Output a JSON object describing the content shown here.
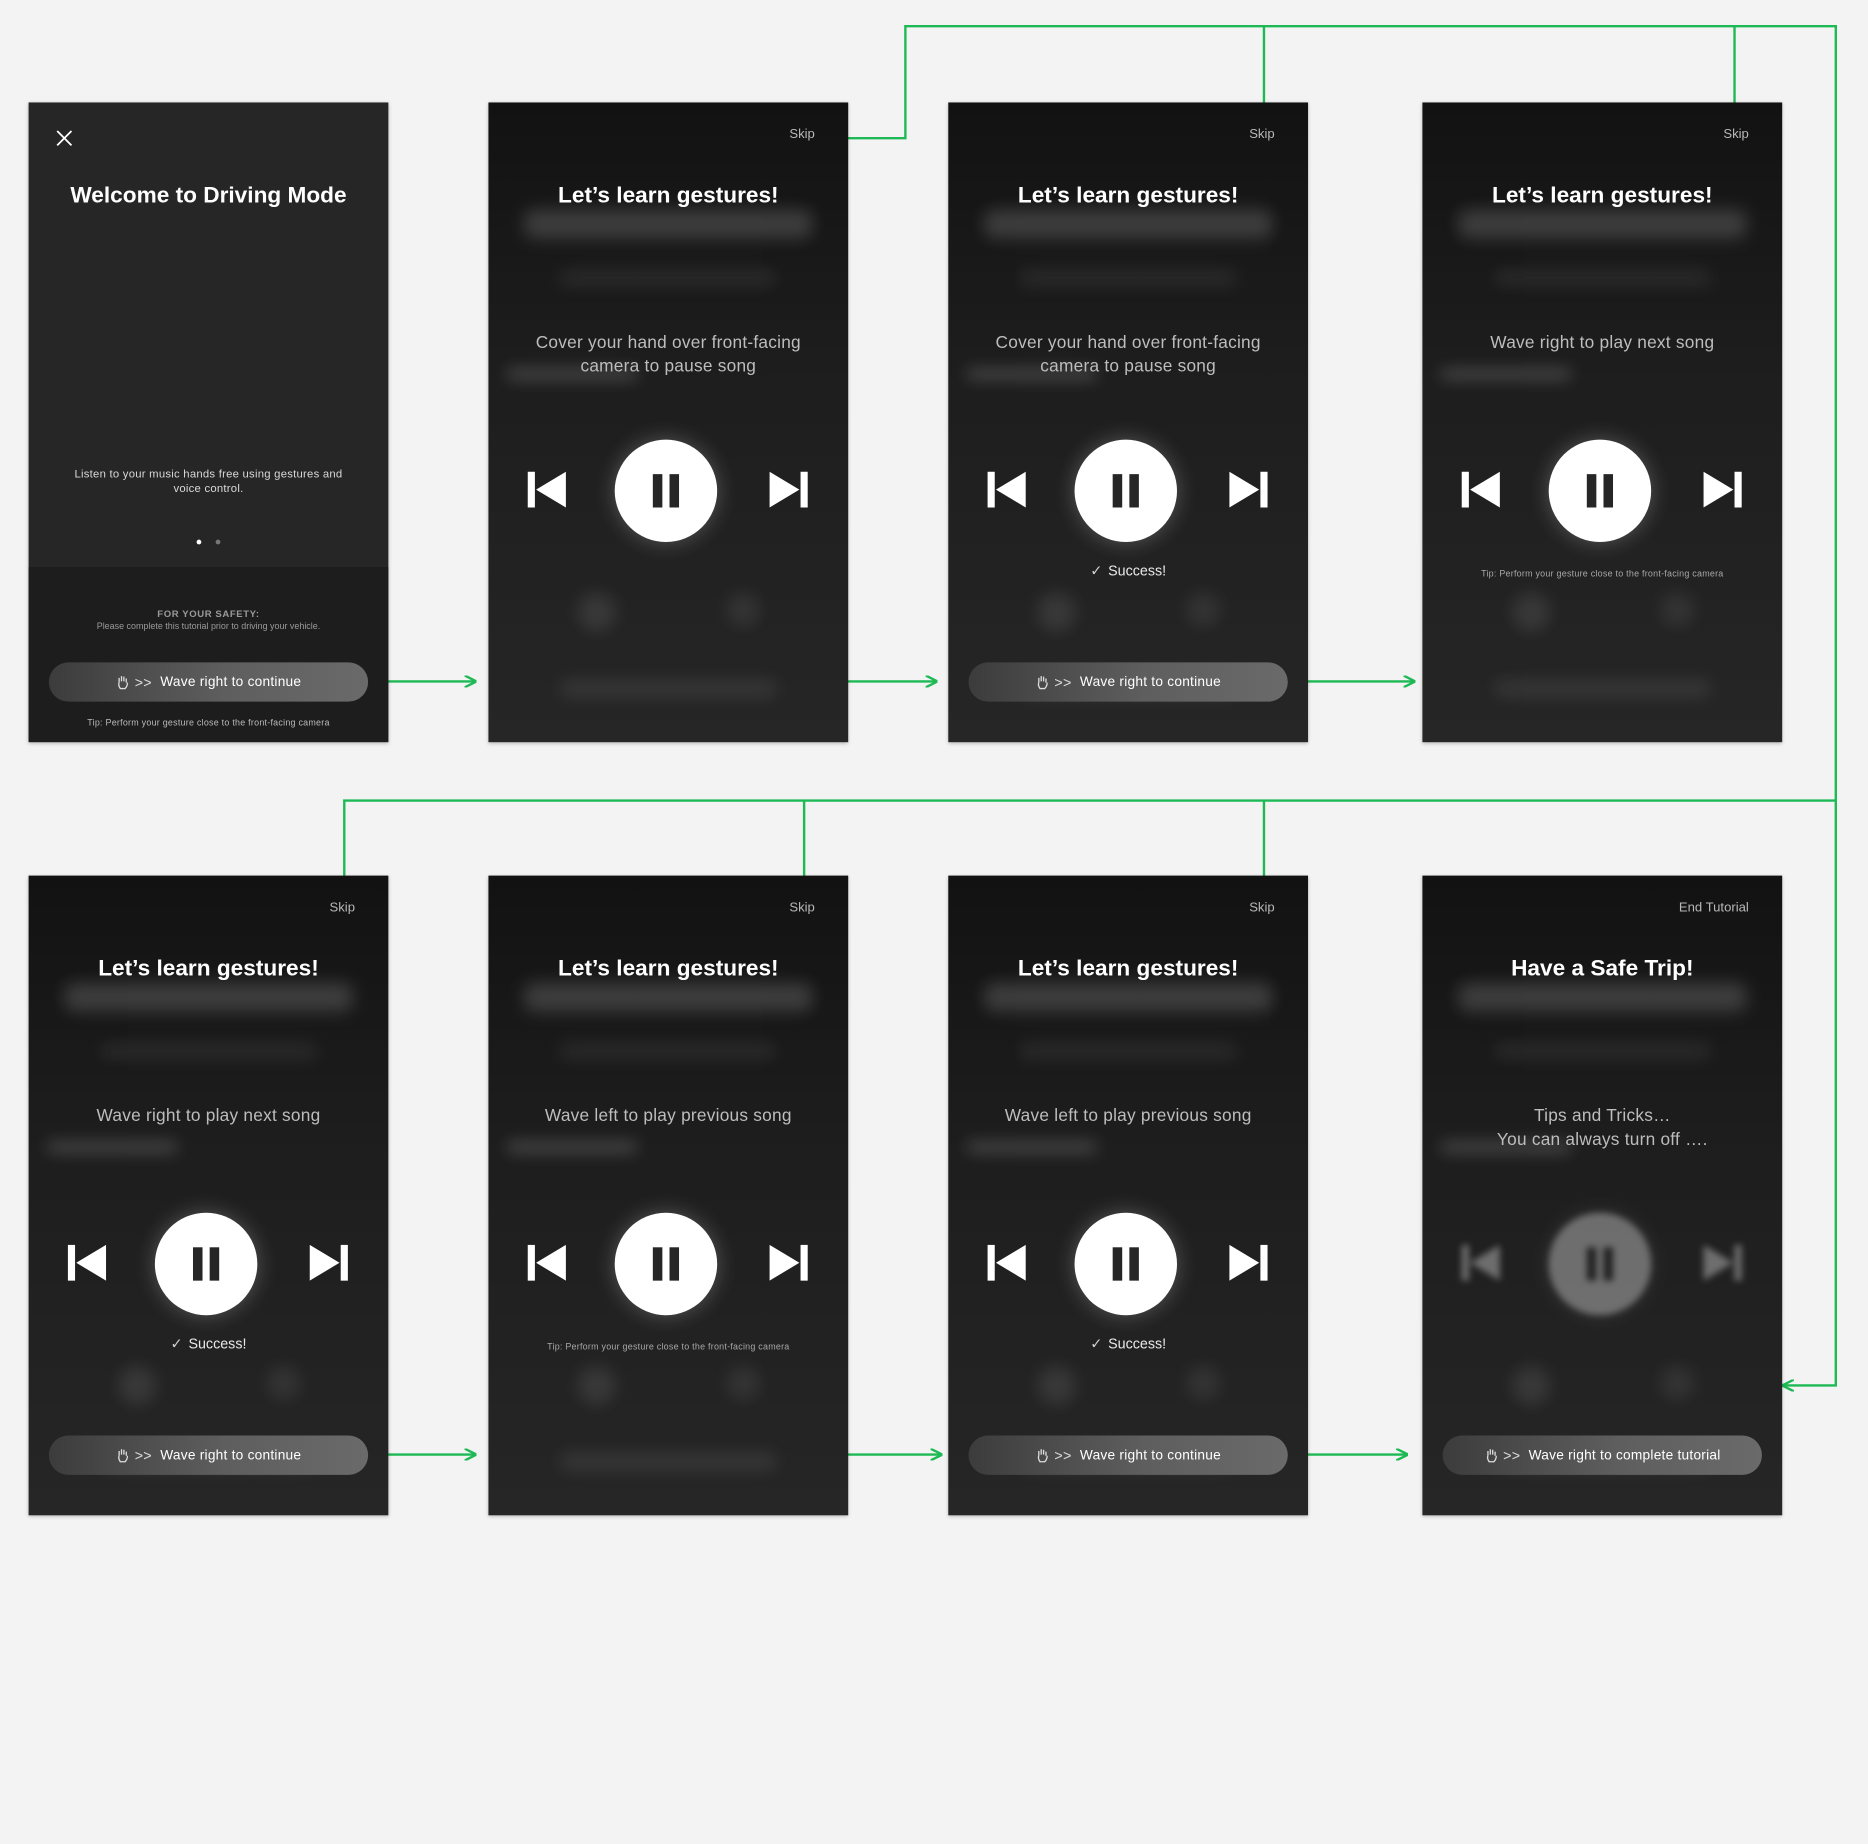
{
  "colors": {
    "connector": "#1db954",
    "screen_bg": "#262626",
    "canvas_bg": "#f3f3f3"
  },
  "welcome": {
    "title": "Welcome to Driving Mode",
    "close_icon": "close-icon",
    "description": "Listen to your music hands free using gestures and voice control.",
    "safety_heading": "FOR YOUR SAFETY:",
    "safety_text": "Please complete this tutorial prior to driving your vehicle.",
    "wave_label": "Wave right to continue",
    "tip": "Tip: Perform your gesture close to the front-facing camera"
  },
  "screens": [
    {
      "skip": "Skip",
      "title": "Let’s learn gestures!",
      "instruction": "Cover your hand over front-facing camera to pause song",
      "tip": "",
      "success": "",
      "wave_label": ""
    },
    {
      "skip": "Skip",
      "title": "Let’s learn gestures!",
      "instruction": "Cover your hand over front-facing camera to pause song",
      "tip": "",
      "success": "Success!",
      "wave_label": "Wave right to continue"
    },
    {
      "skip": "Skip",
      "title": "Let’s learn gestures!",
      "instruction": "Wave right to play next song",
      "tip": "Tip: Perform your gesture close to the front-facing camera",
      "success": "",
      "wave_label": ""
    },
    {
      "skip": "Skip",
      "title": "Let’s learn gestures!",
      "instruction": "Wave right to play next song",
      "tip": "",
      "success": "Success!",
      "wave_label": "Wave right to continue"
    },
    {
      "skip": "Skip",
      "title": "Let’s learn gestures!",
      "instruction": "Wave left to play previous song",
      "tip": "Tip: Perform your gesture close to the front-facing camera",
      "success": "",
      "wave_label": ""
    },
    {
      "skip": "Skip",
      "title": "Let’s learn gestures!",
      "instruction": "Wave left to play previous song",
      "tip": "",
      "success": "Success!",
      "wave_label": "Wave right to continue"
    },
    {
      "skip": "End Tutorial",
      "title": "Have a Safe Trip!",
      "instruction": "Tips and Tricks…\nYou can always turn off ….",
      "tip": "",
      "success": "",
      "wave_label": "Wave right to complete tutorial"
    }
  ]
}
